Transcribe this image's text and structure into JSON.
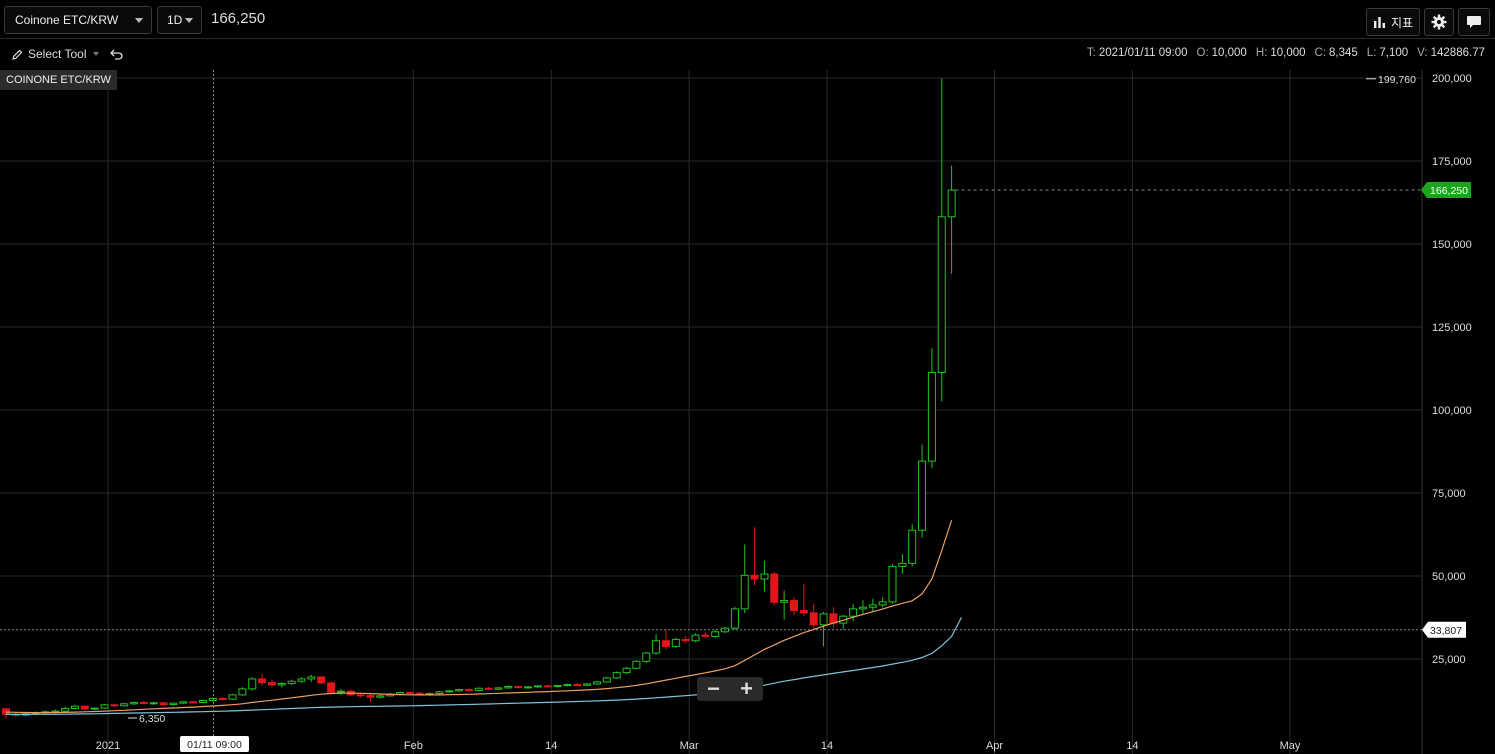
{
  "header": {
    "symbol": "Coinone ETC/KRW",
    "interval": "1D",
    "last_price": "166,250",
    "indicators_label": "지표",
    "icons": [
      "bar-chart-icon",
      "gear-icon",
      "chat-icon"
    ]
  },
  "toolbar": {
    "select_tool": "Select Tool",
    "icons": [
      "pencil-icon",
      "undo-icon"
    ]
  },
  "ohlc": {
    "t_label": "T:",
    "t": "2021/01/11 09:00",
    "o_label": "O:",
    "o": "10,000",
    "h_label": "H:",
    "h": "10,000",
    "c_label": "C:",
    "c": "8,345",
    "l_label": "L:",
    "l": "7,100",
    "v_label": "V:",
    "v": "142886.77"
  },
  "chart_label": "COINONE ETC/KRW",
  "price_axis": [
    "200,000",
    "175,000",
    "150,000",
    "125,000",
    "100,000",
    "75,000",
    "50,000",
    "25,000"
  ],
  "time_axis": [
    "2021",
    "Feb",
    "14",
    "Mar",
    "14",
    "Apr",
    "14",
    "May"
  ],
  "crosshair": {
    "date": "01/11 09:00",
    "price": "33,807"
  },
  "price_tags": {
    "current": "166,250",
    "max": "199,760",
    "min": "6,350"
  },
  "colors": {
    "up": "#23c21e",
    "down": "#e0161b",
    "ma_short": "#e8a060",
    "ma_long": "#7ec4d8",
    "current_tag": "#1aa51a"
  },
  "chart_data": {
    "type": "candlestick",
    "ylim": [
      0,
      205000
    ],
    "candles": [
      [
        10000,
        10000,
        7100,
        8345
      ],
      [
        8345,
        9000,
        7600,
        8100
      ],
      [
        8100,
        8900,
        7700,
        8500
      ],
      [
        8500,
        9200,
        8000,
        8800
      ],
      [
        8800,
        9500,
        8300,
        9100
      ],
      [
        9100,
        9800,
        8600,
        9300
      ],
      [
        9300,
        10500,
        9000,
        10100
      ],
      [
        10100,
        11200,
        9800,
        10800
      ],
      [
        10800,
        11000,
        9500,
        9900
      ],
      [
        9900,
        10400,
        9600,
        10200
      ],
      [
        10200,
        11500,
        10000,
        11200
      ],
      [
        11200,
        11600,
        10600,
        10900
      ],
      [
        10900,
        11800,
        10700,
        11500
      ],
      [
        11500,
        12200,
        11100,
        11900
      ],
      [
        11900,
        12400,
        11300,
        11600
      ],
      [
        11600,
        12100,
        11200,
        11800
      ],
      [
        11800,
        12000,
        11000,
        11300
      ],
      [
        11300,
        11900,
        11000,
        11700
      ],
      [
        11700,
        12300,
        11400,
        12100
      ],
      [
        12100,
        12500,
        11600,
        11900
      ],
      [
        11900,
        12800,
        11700,
        12500
      ],
      [
        12500,
        13400,
        12200,
        13100
      ],
      [
        13100,
        13600,
        12500,
        12900
      ],
      [
        12900,
        14500,
        12700,
        14200
      ],
      [
        14200,
        16500,
        13900,
        16000
      ],
      [
        16000,
        19500,
        15500,
        19000
      ],
      [
        19000,
        20500,
        17000,
        17900
      ],
      [
        17900,
        18800,
        16500,
        17200
      ],
      [
        17200,
        18000,
        16400,
        17600
      ],
      [
        17600,
        18800,
        17200,
        18300
      ],
      [
        18300,
        19500,
        17800,
        19000
      ],
      [
        19000,
        20200,
        18100,
        19600
      ],
      [
        19600,
        19800,
        17500,
        17800
      ],
      [
        17800,
        18200,
        14500,
        15000
      ],
      [
        15000,
        16000,
        14200,
        15300
      ],
      [
        15300,
        15800,
        13800,
        14200
      ],
      [
        14200,
        14900,
        13400,
        14000
      ],
      [
        14000,
        14600,
        12200,
        13500
      ],
      [
        13500,
        14300,
        13100,
        13900
      ],
      [
        13900,
        14800,
        13600,
        14400
      ],
      [
        14400,
        15200,
        14000,
        14900
      ],
      [
        14900,
        15300,
        14200,
        14700
      ],
      [
        14700,
        15100,
        14100,
        14300
      ],
      [
        14300,
        14900,
        13900,
        14600
      ],
      [
        14600,
        15400,
        14300,
        15100
      ],
      [
        15100,
        15700,
        14800,
        15400
      ],
      [
        15400,
        16000,
        15000,
        15800
      ],
      [
        15800,
        16200,
        15200,
        15500
      ],
      [
        15500,
        16400,
        15300,
        16200
      ],
      [
        16200,
        16600,
        15600,
        15900
      ],
      [
        15900,
        16500,
        15600,
        16300
      ],
      [
        16300,
        17100,
        16000,
        16700
      ],
      [
        16700,
        17000,
        16100,
        16400
      ],
      [
        16400,
        16900,
        16000,
        16600
      ],
      [
        16600,
        17100,
        16300,
        16900
      ],
      [
        16900,
        17300,
        16400,
        16700
      ],
      [
        16700,
        17200,
        16400,
        17000
      ],
      [
        17000,
        17600,
        16700,
        17300
      ],
      [
        17300,
        17800,
        16900,
        17100
      ],
      [
        17100,
        17700,
        16900,
        17500
      ],
      [
        17500,
        18400,
        17200,
        18100
      ],
      [
        18100,
        19600,
        17900,
        19300
      ],
      [
        19300,
        21200,
        19000,
        20900
      ],
      [
        20900,
        22600,
        20400,
        22200
      ],
      [
        22200,
        24600,
        21900,
        24300
      ],
      [
        24300,
        27200,
        23800,
        26800
      ],
      [
        26800,
        32500,
        26300,
        30500
      ],
      [
        30500,
        33800,
        27900,
        28800
      ],
      [
        28800,
        31400,
        28300,
        30900
      ],
      [
        30900,
        31900,
        29700,
        30500
      ],
      [
        30500,
        32700,
        30100,
        32200
      ],
      [
        32200,
        33100,
        31300,
        31800
      ],
      [
        31800,
        33800,
        31300,
        33200
      ],
      [
        33200,
        34700,
        32800,
        34300
      ],
      [
        34300,
        40700,
        33800,
        40100
      ],
      [
        40100,
        59500,
        38800,
        50200
      ],
      [
        50200,
        64700,
        47200,
        49100
      ],
      [
        49100,
        54600,
        45300,
        50600
      ],
      [
        50600,
        51200,
        41200,
        42100
      ],
      [
        42100,
        45600,
        36900,
        42600
      ],
      [
        42600,
        43600,
        38200,
        39600
      ],
      [
        39600,
        47600,
        37900,
        38900
      ],
      [
        38900,
        41600,
        33800,
        35300
      ],
      [
        35300,
        39200,
        28800,
        38600
      ],
      [
        38600,
        40600,
        34300,
        35800
      ],
      [
        35800,
        38300,
        33800,
        37900
      ],
      [
        37900,
        41600,
        36400,
        40100
      ],
      [
        40100,
        42700,
        38600,
        40600
      ],
      [
        40600,
        43100,
        39300,
        41300
      ],
      [
        41300,
        43600,
        40600,
        42200
      ],
      [
        42200,
        53600,
        41600,
        52900
      ],
      [
        52900,
        56600,
        50600,
        53800
      ],
      [
        53800,
        65600,
        52900,
        63800
      ],
      [
        63800,
        89600,
        61600,
        84600
      ],
      [
        84600,
        118600,
        82600,
        111300
      ],
      [
        111300,
        199760,
        102600,
        158200
      ],
      [
        158200,
        173600,
        141000,
        166250
      ]
    ],
    "ma_short": [
      9000,
      8950,
      8900,
      8870,
      8860,
      8870,
      8920,
      9000,
      9100,
      9180,
      9300,
      9430,
      9560,
      9700,
      9840,
      9990,
      10120,
      10240,
      10380,
      10520,
      10680,
      10850,
      11020,
      11240,
      11520,
      11920,
      12270,
      12600,
      12950,
      13300,
      13680,
      14080,
      14400,
      14600,
      14700,
      14720,
      14680,
      14580,
      14460,
      14340,
      14260,
      14220,
      14200,
      14190,
      14200,
      14240,
      14300,
      14370,
      14460,
      14560,
      14660,
      14770,
      14880,
      14980,
      15080,
      15190,
      15300,
      15420,
      15540,
      15680,
      15850,
      16080,
      16350,
      16680,
      17060,
      17520,
      18080,
      18640,
      19200,
      19750,
      20300,
      20840,
      21420,
      22050,
      22980,
      24620,
      26240,
      27900,
      29260,
      30620,
      31800,
      32960,
      33880,
      34880,
      35800,
      36680,
      37600,
      38440,
      39260,
      40020,
      40960,
      41770,
      42520,
      44600,
      49100,
      57700,
      66800
    ],
    "ma_long": [
      8300,
      8310,
      8320,
      8330,
      8340,
      8350,
      8380,
      8420,
      8460,
      8500,
      8550,
      8600,
      8660,
      8720,
      8780,
      8840,
      8900,
      8960,
      9020,
      9080,
      9140,
      9210,
      9290,
      9380,
      9480,
      9600,
      9720,
      9840,
      9960,
      10080,
      10200,
      10320,
      10420,
      10500,
      10570,
      10630,
      10680,
      10720,
      10760,
      10800,
      10850,
      10900,
      10960,
      11020,
      11090,
      11160,
      11230,
      11300,
      11380,
      11460,
      11540,
      11620,
      11700,
      11780,
      11860,
      11940,
      12020,
      12110,
      12200,
      12290,
      12390,
      12500,
      12620,
      12760,
      12920,
      13100,
      13300,
      13520,
      13740,
      13960,
      14180,
      14400,
      14640,
      14900,
      15300,
      15900,
      16500,
      17100,
      17700,
      18300,
      18800,
      19300,
      19750,
      20200,
      20650,
      21100,
      21550,
      22000,
      22450,
      22900,
      23450,
      24000,
      24600,
      25450,
      26700,
      29000,
      31800,
      37500
    ]
  }
}
